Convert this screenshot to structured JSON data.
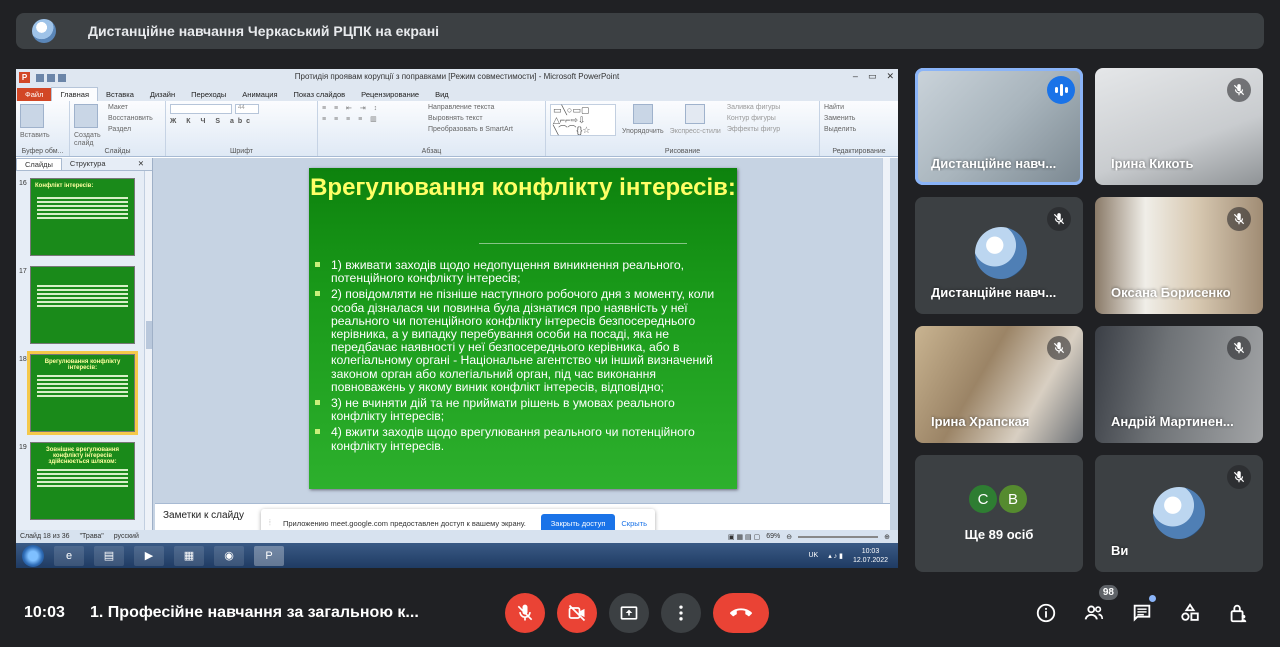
{
  "banner": {
    "title": "Дистанційне навчання Черкаський РЦПК на екрані"
  },
  "powerpoint": {
    "window_title": "Протидія проявам корупції з поправками [Режим совместимости] - Microsoft PowerPoint",
    "tabs": [
      "Файл",
      "Главная",
      "Вставка",
      "Дизайн",
      "Переходы",
      "Анимация",
      "Показ слайдов",
      "Рецензирование",
      "Вид"
    ],
    "active_tab": "Главная",
    "ribbon": {
      "clipboard": {
        "paste": "Вставить",
        "label": "Буфер обм..."
      },
      "slides": {
        "create": "Создать слайд",
        "layout": "Макет",
        "reset": "Восстановить",
        "section": "Раздел",
        "label": "Слайды"
      },
      "font": {
        "size": "44",
        "label": "Шрифт"
      },
      "paragraph": {
        "text_dir": "Направление текста",
        "align": "Выровнять текст",
        "smartart": "Преобразовать в SmartArt",
        "label": "Абзац"
      },
      "drawing": {
        "arrange": "Упорядочить",
        "quick_styles": "Экспресс-стили",
        "fill": "Заливка фигуры",
        "outline": "Контур фигуры",
        "effects": "Эффекты фигур",
        "label": "Рисование"
      },
      "editing": {
        "find": "Найти",
        "replace": "Заменить",
        "select": "Выделить",
        "label": "Редактирование"
      }
    },
    "panel_tabs": [
      "Слайды",
      "Структура"
    ],
    "thumbnails": [
      {
        "num": "16",
        "title": "Конфлікт інтересів:"
      },
      {
        "num": "17",
        "title": ""
      },
      {
        "num": "18",
        "title": "Врегулювання конфлікту інтересів:"
      },
      {
        "num": "19",
        "title": "Зовнішнє врегулювання конфлікту інтересів здійснюється шляхом:"
      }
    ],
    "slide": {
      "title": "Врегулювання конфлікту інтересів:",
      "bullets": [
        "1) вживати заходів щодо недопущення виникнення реального, потенційного конфлікту інтересів;",
        "2) повідомляти не пізніше наступного робочого дня з моменту, коли особа дізналася чи повинна була дізнатися про наявність у неї реального чи потенційного конфлікту інтересів безпосереднього керівника, а у випадку перебування особи на посаді, яка не передбачає наявності у неї безпосереднього керівника, або в колегіальному органі - Національне агентство чи інший визначений законом орган або колегіальний орган, під час виконання повноважень у якому виник конфлікт інтересів, відповідно;",
        "3) не вчиняти дій та не приймати рішень в умовах реального конфлікту інтересів;",
        "4) вжити заходів щодо врегулювання реального чи потенційного конфлікту інтересів."
      ]
    },
    "notes_placeholder": "Заметки к слайду",
    "permission_bar": {
      "message": "Приложению meet.google.com предоставлен доступ к вашему экрану.",
      "stop": "Закрыть доступ",
      "hide": "Скрыть"
    },
    "status": {
      "slide": "Слайд 18 из 36",
      "theme": "\"Трава\"",
      "lang": "русский",
      "zoom": "69%"
    },
    "taskbar": {
      "lang": "UK",
      "time": "10:03",
      "date": "12.07.2022"
    }
  },
  "participants": [
    {
      "name": "Дистанційне навч...",
      "speaking": true
    },
    {
      "name": "Ірина Кикоть"
    },
    {
      "name": "Дистанційне навч..."
    },
    {
      "name": "Оксана Борисенко"
    },
    {
      "name": "Ірина Храпская"
    },
    {
      "name": "Андрій Мартинен..."
    },
    {
      "others_label": "Ще 89 осіб",
      "initials": [
        "С",
        "В"
      ],
      "initial_colors": [
        "#2e7d32",
        "#558b2f"
      ]
    },
    {
      "name": "Ви"
    }
  ],
  "bottom": {
    "time": "10:03",
    "meeting_title": "1. Професійне навчання за загальною к...",
    "people_count": "98"
  },
  "colors": {
    "accent": "#8ab4f8",
    "danger": "#ea4335",
    "slide_title": "#ffff66"
  }
}
